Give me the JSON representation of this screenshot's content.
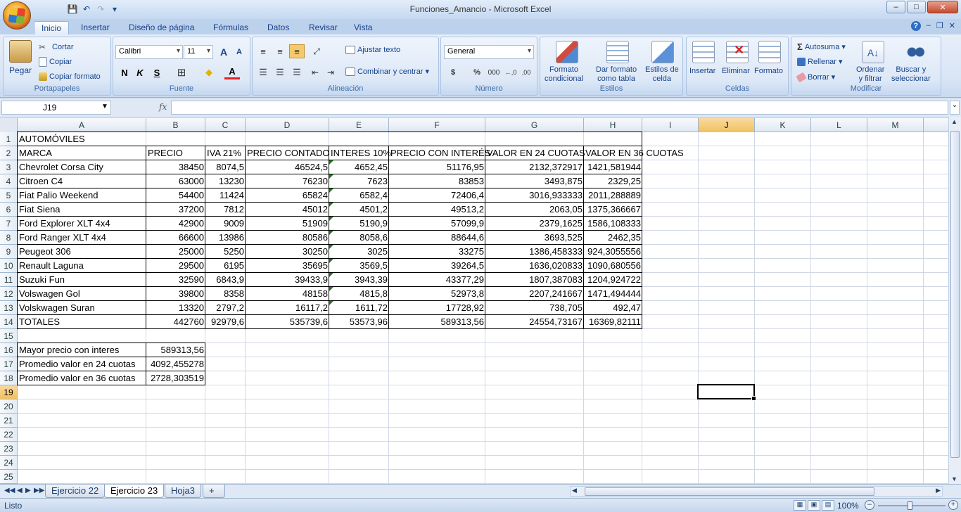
{
  "window": {
    "title": "Funciones_Amancio - Microsoft Excel",
    "min_label": "–",
    "max_label": "□",
    "close_label": "✕"
  },
  "qat": {
    "save": "💾",
    "undo": "↶",
    "redo": "↷",
    "customize": "▾"
  },
  "tabs": [
    "Inicio",
    "Insertar",
    "Diseño de página",
    "Fórmulas",
    "Datos",
    "Revisar",
    "Vista"
  ],
  "tab_controls": {
    "help": "?",
    "min": "–",
    "restore": "❐",
    "close": "✕"
  },
  "ribbon": {
    "portapapeles": {
      "label": "Portapapeles",
      "pegar": "Pegar",
      "cortar": "Cortar",
      "copiar": "Copiar",
      "copiar_formato": "Copiar formato"
    },
    "fuente": {
      "label": "Fuente",
      "font_name": "Calibri",
      "font_size": "11",
      "grow": "A",
      "shrink": "A",
      "bold": "N",
      "italic": "K",
      "underline": "S",
      "border": "⊞",
      "fill": "◆",
      "color": "A"
    },
    "alineacion": {
      "label": "Alineación",
      "ajustar": "Ajustar texto",
      "combinar": "Combinar y centrar"
    },
    "numero": {
      "label": "Número",
      "format": "General",
      "currency": "$",
      "percent": "%",
      "thousands": "000",
      "inc_dec": "←,0",
      "dec_dec": ",00"
    },
    "estilos": {
      "label": "Estilos",
      "formato_condicional": [
        "Formato",
        "condicional"
      ],
      "dar_formato": [
        "Dar formato",
        "como tabla"
      ],
      "estilos_celda": [
        "Estilos de",
        "celda"
      ]
    },
    "celdas": {
      "label": "Celdas",
      "insertar": "Insertar",
      "eliminar": "Eliminar",
      "formato": "Formato"
    },
    "modificar": {
      "label": "Modificar",
      "autosuma": "Autosuma",
      "rellenar": "Rellenar",
      "borrar": "Borrar",
      "ordenar": [
        "Ordenar",
        "y filtrar"
      ],
      "buscar": [
        "Buscar y",
        "seleccionar"
      ]
    }
  },
  "formula_bar": {
    "name_box": "J19",
    "fx": "fx",
    "formula": ""
  },
  "columns": [
    "A",
    "B",
    "C",
    "D",
    "E",
    "F",
    "G",
    "H",
    "I",
    "J",
    "K",
    "L",
    "M"
  ],
  "selected_column": "J",
  "selected_row": "19",
  "rows": [
    "1",
    "2",
    "3",
    "4",
    "5",
    "6",
    "7",
    "8",
    "9",
    "10",
    "11",
    "12",
    "13",
    "14",
    "15",
    "16",
    "17",
    "18",
    "19",
    "20",
    "21",
    "22",
    "23",
    "24",
    "25"
  ],
  "sheet": {
    "title": "AUTOMÓVILES",
    "headers": [
      "MARCA",
      "PRECIO",
      "IVA 21%",
      "PRECIO CONTADO",
      "INTERES 10%",
      "PRECIO CON INTERÉS",
      "VALOR EN 24 CUOTAS",
      "VALOR EN 36 CUOTAS"
    ],
    "data": [
      [
        "Chevrolet Corsa City",
        "38450",
        "8074,5",
        "46524,5",
        "4652,45",
        "51176,95",
        "2132,372917",
        "1421,581944"
      ],
      [
        "Citroen C4",
        "63000",
        "13230",
        "76230",
        "7623",
        "83853",
        "3493,875",
        "2329,25"
      ],
      [
        "Fiat Palio Weekend",
        "54400",
        "11424",
        "65824",
        "6582,4",
        "72406,4",
        "3016,933333",
        "2011,288889"
      ],
      [
        "Fiat Siena",
        "37200",
        "7812",
        "45012",
        "4501,2",
        "49513,2",
        "2063,05",
        "1375,366667"
      ],
      [
        "Ford Explorer XLT 4x4",
        "42900",
        "9009",
        "51909",
        "5190,9",
        "57099,9",
        "2379,1625",
        "1586,108333"
      ],
      [
        "Ford Ranger XLT 4x4",
        "66600",
        "13986",
        "80586",
        "8058,6",
        "88644,6",
        "3693,525",
        "2462,35"
      ],
      [
        "Peugeot 306",
        "25000",
        "5250",
        "30250",
        "3025",
        "33275",
        "1386,458333",
        "924,3055556"
      ],
      [
        "Renault Laguna",
        "29500",
        "6195",
        "35695",
        "3569,5",
        "39264,5",
        "1636,020833",
        "1090,680556"
      ],
      [
        "Suzuki Fun",
        "32590",
        "6843,9",
        "39433,9",
        "3943,39",
        "43377,29",
        "1807,387083",
        "1204,924722"
      ],
      [
        "Volswagen Gol",
        "39800",
        "8358",
        "48158",
        "4815,8",
        "52973,8",
        "2207,241667",
        "1471,494444"
      ],
      [
        "Volskwagen Suran",
        "13320",
        "2797,2",
        "16117,2",
        "1611,72",
        "17728,92",
        "738,705",
        "492,47"
      ]
    ],
    "totals": [
      "TOTALES",
      "442760",
      "92979,6",
      "535739,6",
      "53573,96",
      "589313,56",
      "24554,73167",
      "16369,82111"
    ],
    "summary": [
      [
        "Mayor precio con interes",
        "589313,56"
      ],
      [
        "Promedio valor en 24 cuotas",
        "4092,455278"
      ],
      [
        "Promedio valor en 36 cuotas",
        "2728,303519"
      ]
    ]
  },
  "sheet_tabs": [
    "Ejercicio 22",
    "Ejercicio 23",
    "Hoja3"
  ],
  "active_sheet": "Ejercicio 23",
  "status": {
    "text": "Listo",
    "zoom": "100%",
    "zoom_minus": "–",
    "zoom_plus": "+"
  }
}
